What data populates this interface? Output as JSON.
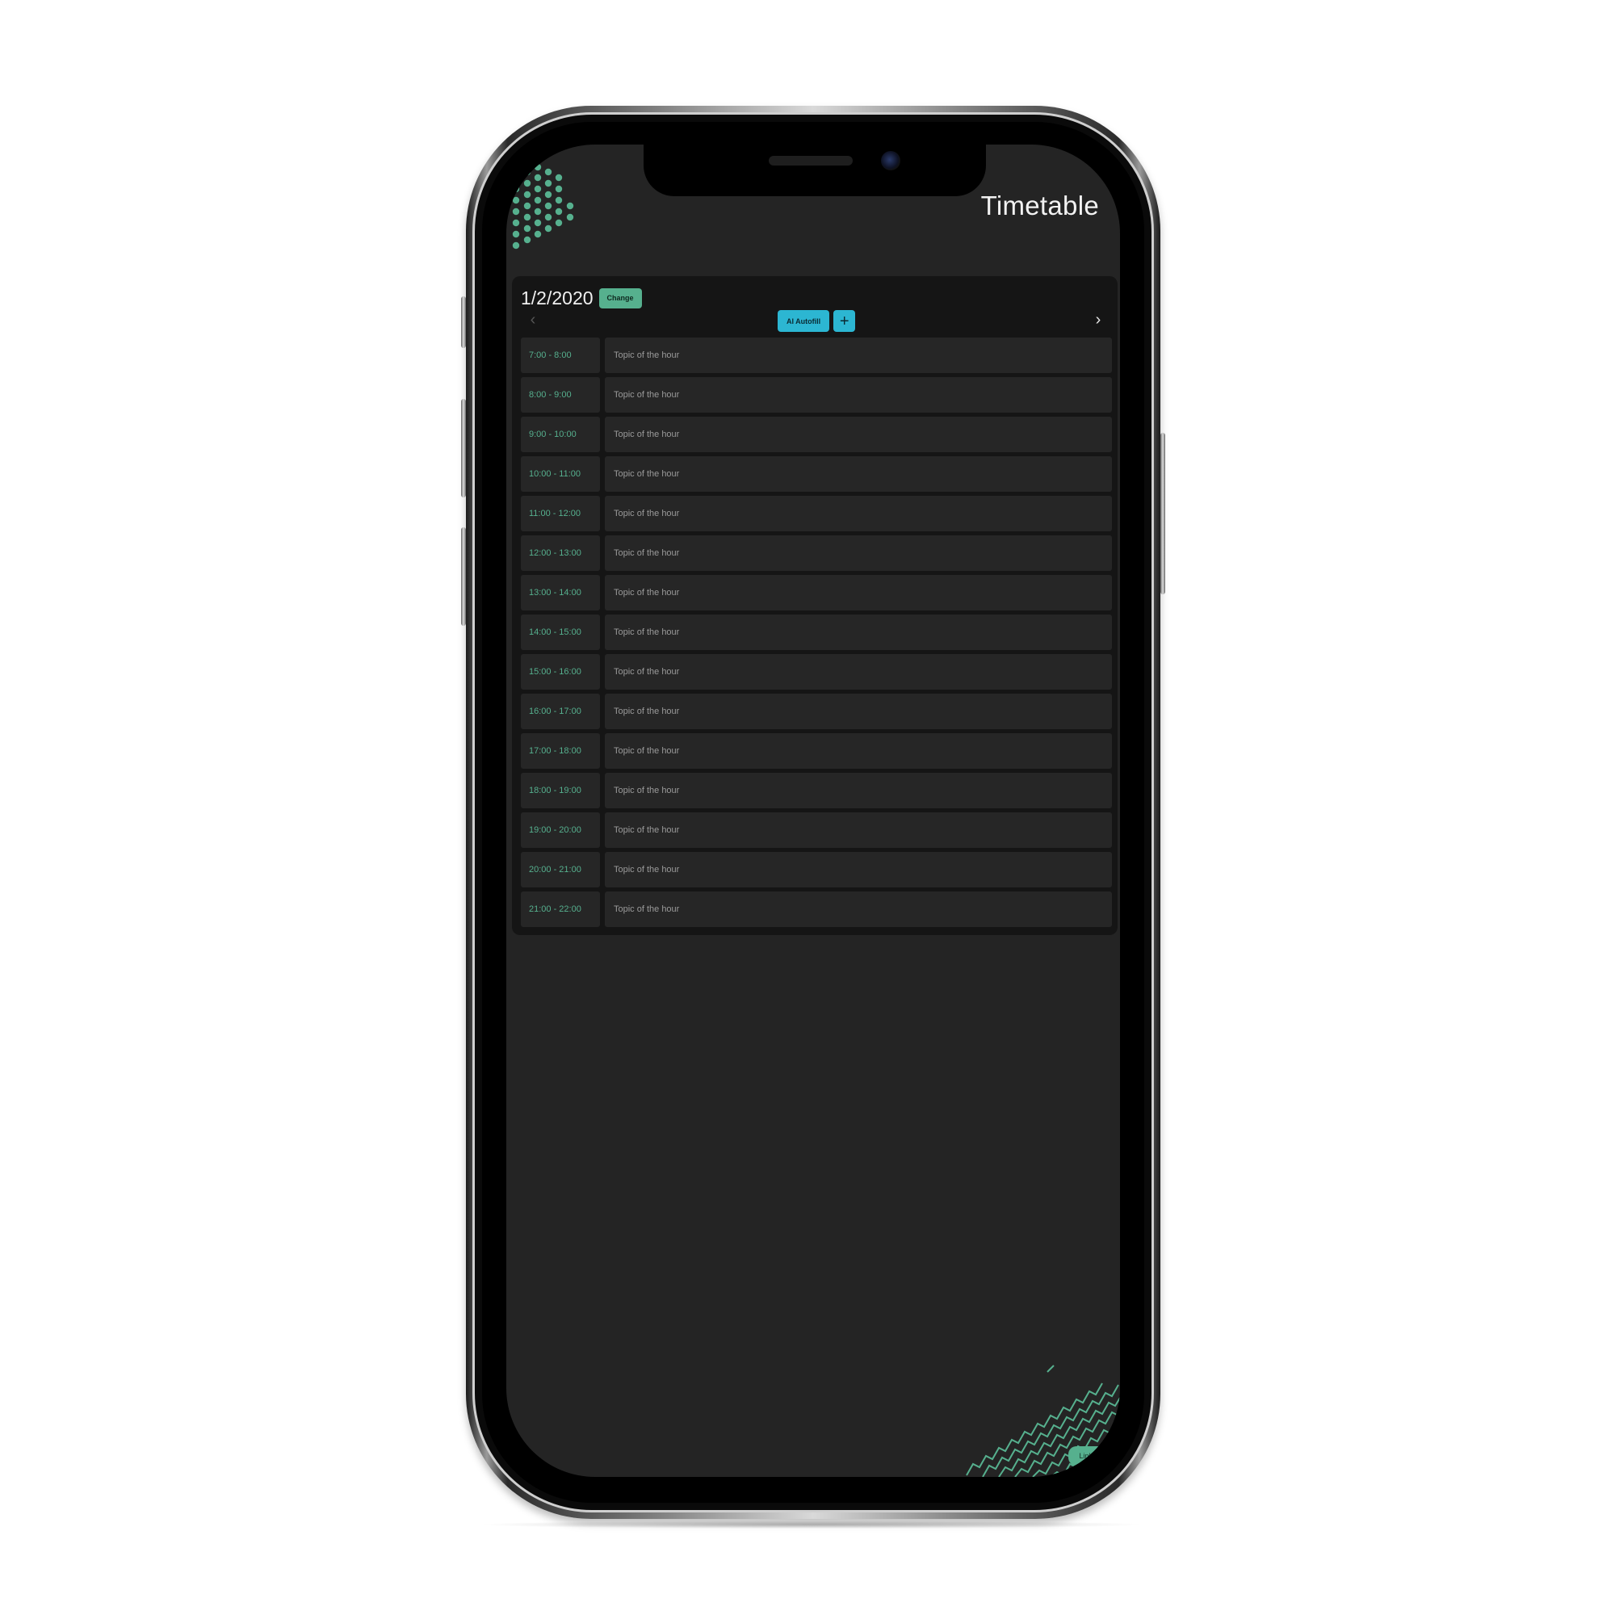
{
  "app": {
    "title": "Timetable"
  },
  "date_bar": {
    "date": "1/2/2020",
    "change_label": "Change"
  },
  "nav": {
    "prev_arrow": "‹",
    "next_arrow": "›",
    "ai_autofill_label": "AI Autofill",
    "add_label": "+"
  },
  "slots": [
    {
      "time": "7:00 - 8:00",
      "topic_placeholder": "Topic of the hour"
    },
    {
      "time": "8:00 - 9:00",
      "topic_placeholder": "Topic of the hour"
    },
    {
      "time": "9:00 - 10:00",
      "topic_placeholder": "Topic of the hour"
    },
    {
      "time": "10:00 - 11:00",
      "topic_placeholder": "Topic of the hour"
    },
    {
      "time": "11:00 - 12:00",
      "topic_placeholder": "Topic of the hour"
    },
    {
      "time": "12:00 - 13:00",
      "topic_placeholder": "Topic of the hour"
    },
    {
      "time": "13:00 - 14:00",
      "topic_placeholder": "Topic of the hour"
    },
    {
      "time": "14:00 - 15:00",
      "topic_placeholder": "Topic of the hour"
    },
    {
      "time": "15:00 - 16:00",
      "topic_placeholder": "Topic of the hour"
    },
    {
      "time": "16:00 - 17:00",
      "topic_placeholder": "Topic of the hour"
    },
    {
      "time": "17:00 - 18:00",
      "topic_placeholder": "Topic of the hour"
    },
    {
      "time": "18:00 - 19:00",
      "topic_placeholder": "Topic of the hour"
    },
    {
      "time": "19:00 - 20:00",
      "topic_placeholder": "Topic of the hour"
    },
    {
      "time": "20:00 - 21:00",
      "topic_placeholder": "Topic of the hour"
    },
    {
      "time": "21:00 - 22:00",
      "topic_placeholder": "Topic of the hour"
    }
  ],
  "footer": {
    "links_label": "Links"
  },
  "colors": {
    "accent_green": "#56b08e",
    "accent_cyan": "#2cb6d2",
    "background": "#242424",
    "card": "#151515",
    "cell": "#262626"
  },
  "icons": {
    "prev": "chevron-left-icon",
    "next": "chevron-right-icon",
    "add": "plus-icon"
  }
}
